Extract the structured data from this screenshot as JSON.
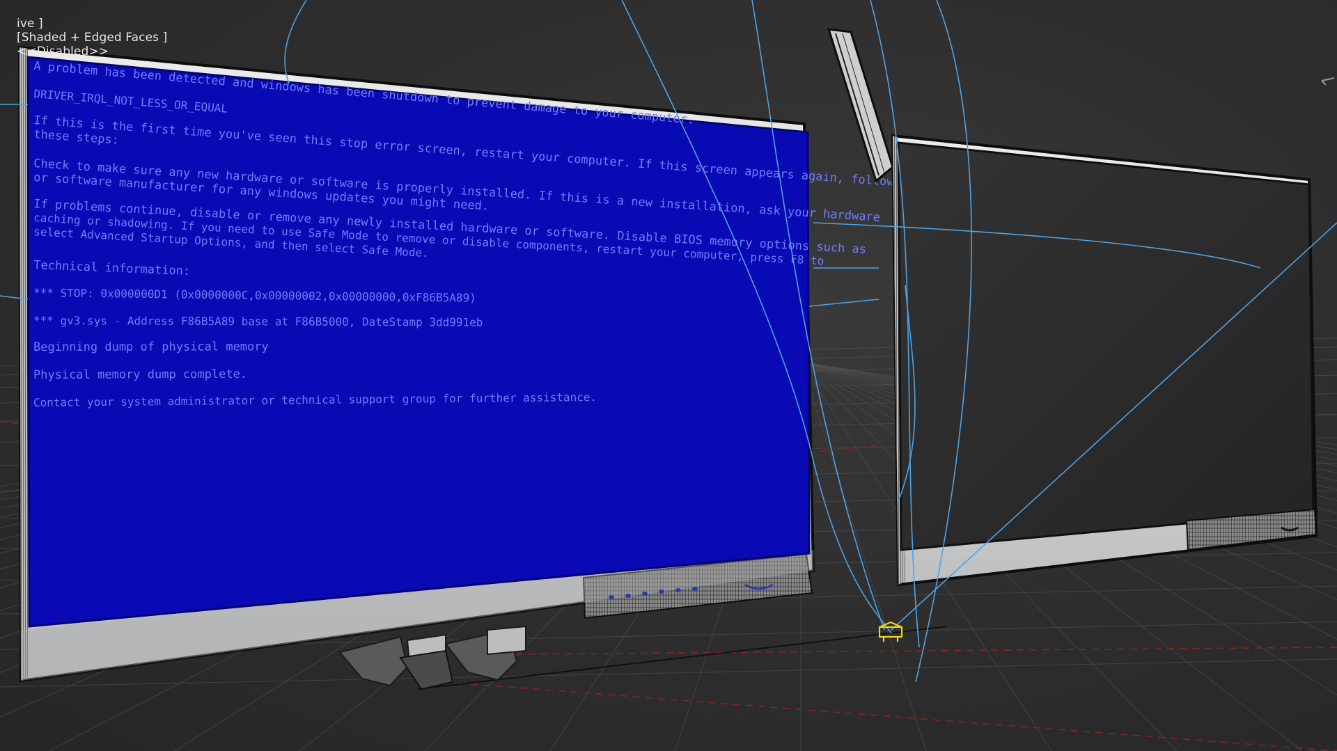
{
  "viewport": {
    "label_view": "ive ]",
    "label_shading": "[Shaded + Edged Faces ]",
    "label_disabled": "<<Disabled>>"
  },
  "colors": {
    "background": "#2e2e2e",
    "grid": "#555555",
    "axis_red": "#8a2222",
    "bsod_blue": "#0a0ab4",
    "bsod_text": "#6f7cff",
    "bezel": "#d9dadc",
    "dark_screen": "#2b2b2b",
    "wire": "#4fa3e6",
    "gizmo": "#f2d21a"
  },
  "bsod": {
    "lines": [
      "A problem has been detected and windows has been shutdown to prevent damage to your computer.",
      "DRIVER_IRQL_NOT_LESS_OR_EQUAL",
      "If this is the first time you've seen this stop error screen, restart your computer. If this screen appears again, follow",
      "these steps:",
      "Check to make sure any new hardware or software is properly installed. If this is a new installation, ask your hardware",
      "or software manufacturer for any windows updates you might need.",
      "If problems continue, disable or remove any newly installed hardware or software. Disable BIOS memory options such as",
      "caching or shadowing. If you need to use Safe Mode to remove or disable components, restart your computer, press F8 to",
      "select Advanced Startup Options, and then select Safe Mode.",
      "Technical information:",
      "*** STOP: 0x000000D1 (0x0000000C,0x00000002,0x00000000,0xF86B5A89)",
      "*** gv3.sys - Address F86B5A89 base at F86B5000, DateStamp 3dd991eb",
      "Beginning dump of physical memory",
      "Physical memory dump complete.",
      "Contact your system administrator or technical support group for further assistance."
    ]
  }
}
